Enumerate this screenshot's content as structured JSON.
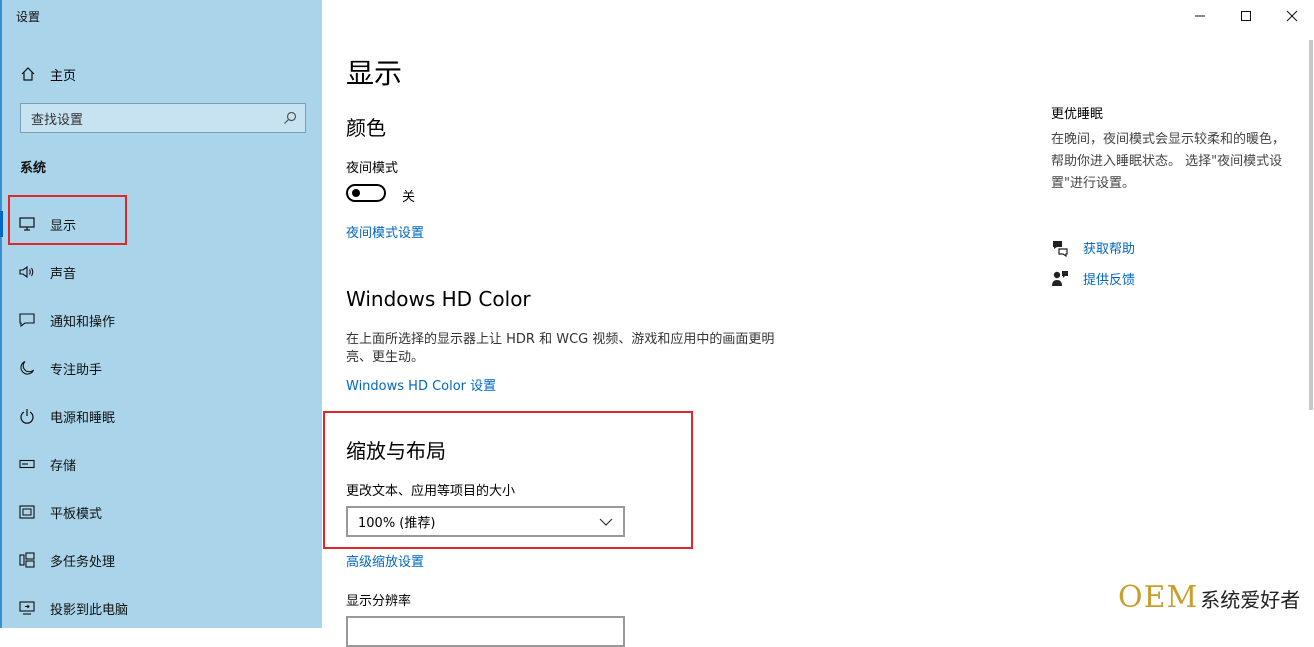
{
  "window": {
    "title": "设置"
  },
  "sidebar": {
    "home_label": "主页",
    "search_placeholder": "查找设置",
    "section_label": "系统",
    "items": [
      {
        "label": "显示",
        "icon": "monitor-icon",
        "selected": true
      },
      {
        "label": "声音",
        "icon": "speaker-icon"
      },
      {
        "label": "通知和操作",
        "icon": "notification-icon"
      },
      {
        "label": "专注助手",
        "icon": "moon-icon"
      },
      {
        "label": "电源和睡眠",
        "icon": "power-icon"
      },
      {
        "label": "存储",
        "icon": "storage-icon"
      },
      {
        "label": "平板模式",
        "icon": "tablet-icon"
      },
      {
        "label": "多任务处理",
        "icon": "multitask-icon"
      },
      {
        "label": "投影到此电脑",
        "icon": "project-icon"
      }
    ]
  },
  "main": {
    "title": "显示",
    "color_heading": "颜色",
    "night_mode_label": "夜间模式",
    "night_mode_state": "关",
    "night_mode_settings_link": "夜间模式设置",
    "hdr_heading": "Windows HD Color",
    "hdr_desc": "在上面所选择的显示器上让 HDR 和 WCG 视频、游戏和应用中的画面更明亮、更生动。",
    "hdr_link": "Windows HD Color 设置",
    "scale_heading": "缩放与布局",
    "scale_label": "更改文本、应用等项目的大小",
    "scale_value": "100% (推荐)",
    "advanced_scale_link": "高级缩放设置",
    "resolution_label": "显示分辨率"
  },
  "right_panel": {
    "heading": "更优睡眠",
    "desc": "在晚间，夜间模式会显示较柔和的暖色，帮助你进入睡眠状态。 选择\"夜间模式设置\"进行设置。",
    "help_link": "获取帮助",
    "feedback_link": "提供反馈"
  },
  "watermark": {
    "brand": "OEM",
    "text": "系统爱好者"
  },
  "colors": {
    "accent": "#0067c0",
    "sidebar_bg": "#a9d4ea",
    "highlight": "#e2252b"
  }
}
